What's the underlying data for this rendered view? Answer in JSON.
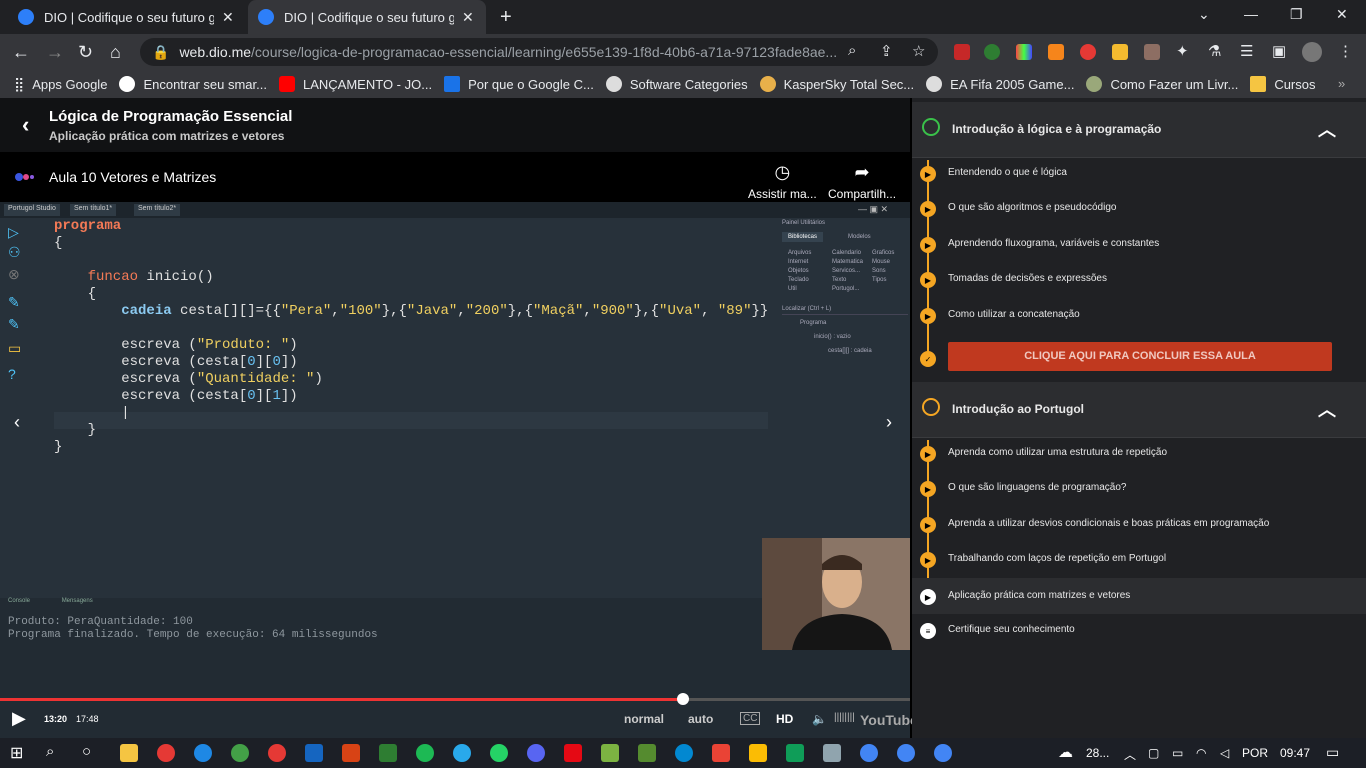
{
  "browser": {
    "tabs": [
      {
        "title": "DIO | Codifique o seu futuro glob",
        "close": "✕"
      },
      {
        "title": "DIO | Codifique o seu futuro glob",
        "close": "✕"
      }
    ],
    "new_tab": "+",
    "url_host": "web.dio.me",
    "url_path": "/course/logica-de-programacao-essencial/learning/e655e139-1f8d-40b6-a71a-97123fade8ae...",
    "bookmarks": [
      {
        "label": "Apps Google",
        "color": "#4285f4"
      },
      {
        "label": "Encontrar seu smar...",
        "color": "#ffffff"
      },
      {
        "label": "LANÇAMENTO - JO...",
        "color": "#ff0000"
      },
      {
        "label": "Por que o Google C...",
        "color": "#1a73e8"
      },
      {
        "label": "Software Categories",
        "color": "#ffffff"
      },
      {
        "label": "KasperSky Total Sec...",
        "color": "#e8b04a"
      },
      {
        "label": "EA Fifa 2005 Game...",
        "color": "#ffffff"
      },
      {
        "label": "Como Fazer um Livr...",
        "color": "#9aa87a"
      },
      {
        "label": "Cursos",
        "color": "#f5c542"
      }
    ]
  },
  "course": {
    "title": "Lógica de Programação Essencial",
    "subtitle": "Aplicação prática com matrizes e vetores"
  },
  "video": {
    "title": "Aula 10 Vetores e Matrizes",
    "watch_later": "Assistir ma...",
    "share": "Compartilh...",
    "time_current": "13:20",
    "time_total": "17:48",
    "progress_fraction": 0.75,
    "speed": "normal",
    "quality_mode": "auto",
    "quality": "HD",
    "youtube": "YouTube"
  },
  "ide": {
    "tabs": [
      "Portugol Studio",
      "Sem título1*",
      "Sem título2*"
    ],
    "code": [
      "programa",
      "{",
      "",
      "    funcao inicio()",
      "    {",
      "        cadeia cesta[][]={{\"Pera\",\"100\"},{\"Java\",\"200\"},{\"Maçã\",\"900\"},{\"Uva\", \"89\"}}",
      "",
      "        escreva (\"Produto: \")",
      "        escreva (cesta[0][0])",
      "        escreva (\"Quantidade: \")",
      "        escreva (cesta[0][1])",
      "",
      "    }",
      "}"
    ],
    "panel_title": "Painel Utilitários",
    "panel_tabs": [
      "Bibliotecas",
      "Modelos"
    ],
    "libraries": [
      "Arquivos",
      "Calendario",
      "Graficos",
      "Internet",
      "Matematica",
      "Mouse",
      "Objetos",
      "Servicos...",
      "Sons",
      "Teclado",
      "Texto",
      "Tipos",
      "Util",
      "Portugol..."
    ],
    "locator": "Localizar (Ctrl + L)",
    "tree": [
      "Programa",
      "inicio() : vazio",
      "cesta[][] : cadeia"
    ],
    "console_tabs": [
      "Console",
      "Mensagens"
    ],
    "console_lines": [
      "Produto: PeraQuantidade: 100",
      "Programa finalizado. Tempo de execução: 64 milissegundos"
    ]
  },
  "sidebar": {
    "sections": [
      {
        "title": "Introdução à lógica e à programação",
        "lessons": [
          "Entendendo o que é lógica",
          "O que são algoritmos e pseudocódigo",
          "Aprendendo fluxograma, variáveis e constantes",
          "Tomadas de decisões e expressões",
          "Como utilizar a concatenação"
        ],
        "conclude": "CLIQUE AQUI PARA CONCLUIR ESSA AULA"
      },
      {
        "title": "Introdução ao Portugol",
        "lessons": [
          "Aprenda como utilizar uma estrutura de repetição",
          "O que são linguagens de programação?",
          "Aprenda a utilizar desvios condicionais e boas práticas em programação",
          "Trabalhando com laços de repetição em Portugol",
          "Aplicação prática com matrizes e vetores",
          "Certifique seu conhecimento"
        ]
      }
    ]
  },
  "taskbar": {
    "weather": "28...",
    "lang": "POR",
    "time": "09:47"
  }
}
